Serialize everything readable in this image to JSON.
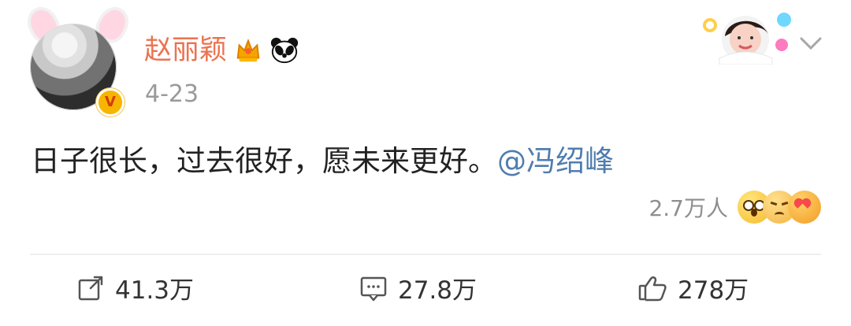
{
  "user": {
    "name": "赵丽颖",
    "date": "4-23",
    "verified_icon": "verified-v-icon",
    "badge_icons": [
      "crown-icon",
      "panda-icon"
    ],
    "accent_color": "#eb7350"
  },
  "post": {
    "text": "日子很长，过去很好，愿未来更好。",
    "mention": "@冯绍峰",
    "reaction_count": "2.7万人",
    "reaction_icons": [
      "wow-emoji",
      "sad-emoji",
      "love-emoji"
    ]
  },
  "actions": {
    "repost": "41.3万",
    "comment": "27.8万",
    "like": "278万"
  }
}
